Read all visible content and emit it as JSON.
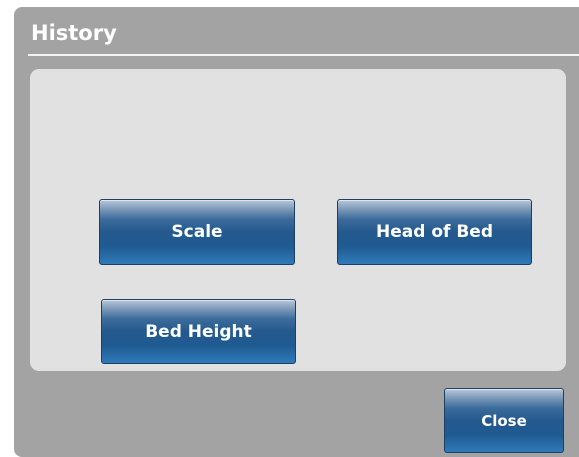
{
  "dialog": {
    "title": "History"
  },
  "buttons": {
    "scale": "Scale",
    "head_of_bed": "Head of Bed",
    "bed_height": "Bed Height"
  },
  "footer": {
    "close_label": "Close"
  }
}
